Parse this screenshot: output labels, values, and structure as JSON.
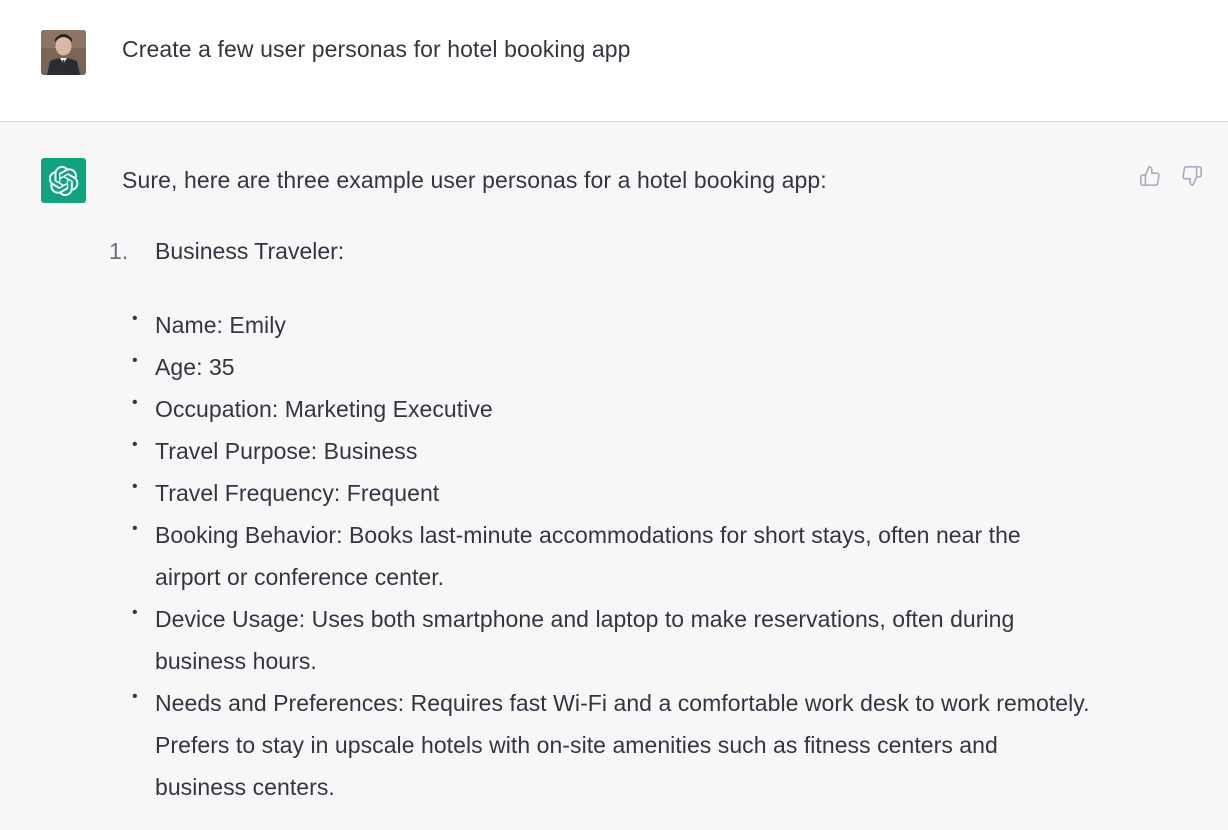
{
  "user_turn": {
    "message": "Create a few user personas for hotel booking app",
    "avatar": "user-avatar-photo"
  },
  "assistant_turn": {
    "avatar_icon": "openai-logo-icon",
    "intro": "Sure, here are three example user personas for a hotel booking app:",
    "feedback": {
      "thumbs_up_icon": "thumbs-up-icon",
      "thumbs_down_icon": "thumbs-down-icon"
    },
    "ordered_items": [
      {
        "number": "1.",
        "title": "Business Traveler:",
        "bullets": [
          "Name: Emily",
          "Age: 35",
          "Occupation: Marketing Executive",
          "Travel Purpose: Business",
          "Travel Frequency: Frequent",
          "Booking Behavior: Books last-minute accommodations for short stays, often near the airport or conference center.",
          "Device Usage: Uses both smartphone and laptop to make reservations, often during business hours.",
          "Needs and Preferences: Requires fast Wi-Fi and a comfortable work desk to work remotely. Prefers to stay in upscale hotels with on-site amenities such as fitness centers and business centers."
        ]
      }
    ]
  },
  "colors": {
    "text": "#343541",
    "assistant_bg": "#f7f7f8",
    "user_bg": "#ffffff",
    "brand_green": "#10a37f",
    "icon_gray": "#acacbe"
  }
}
